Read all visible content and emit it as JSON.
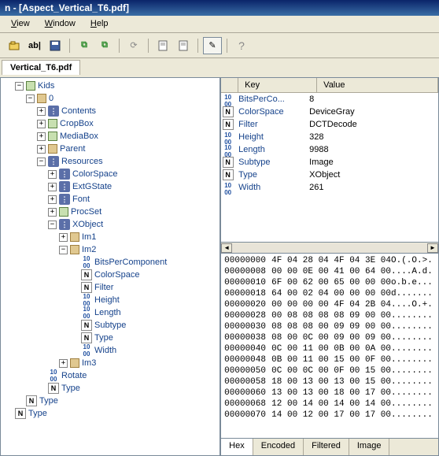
{
  "title": "n - [Aspect_Vertical_T6.pdf]",
  "menu": {
    "view": "View",
    "window": "Window",
    "help": "Help"
  },
  "toolbar": {
    "ab": "ab|",
    "help": "?"
  },
  "tab": "Vertical_T6.pdf",
  "tree": [
    {
      "d": 0,
      "exp": "-",
      "icon": "arr",
      "label": "Kids"
    },
    {
      "d": 1,
      "exp": "-",
      "icon": "dict",
      "label": "0"
    },
    {
      "d": 2,
      "exp": "+",
      "icon": "kv",
      "label": "Contents"
    },
    {
      "d": 2,
      "exp": "+",
      "icon": "arr",
      "label": "CropBox"
    },
    {
      "d": 2,
      "exp": "+",
      "icon": "arr",
      "label": "MediaBox"
    },
    {
      "d": 2,
      "exp": "+",
      "icon": "dict",
      "label": "Parent"
    },
    {
      "d": 2,
      "exp": "-",
      "icon": "kv",
      "label": "Resources"
    },
    {
      "d": 3,
      "exp": "+",
      "icon": "kv",
      "label": "ColorSpace"
    },
    {
      "d": 3,
      "exp": "+",
      "icon": "kv",
      "label": "ExtGState"
    },
    {
      "d": 3,
      "exp": "+",
      "icon": "kv",
      "label": "Font"
    },
    {
      "d": 3,
      "exp": "+",
      "icon": "arr",
      "label": "ProcSet"
    },
    {
      "d": 3,
      "exp": "-",
      "icon": "kv",
      "label": "XObject"
    },
    {
      "d": 4,
      "exp": "+",
      "icon": "dict",
      "label": "Im1"
    },
    {
      "d": 4,
      "exp": "-",
      "icon": "dict",
      "label": "Im2"
    },
    {
      "d": 5,
      "exp": "",
      "icon": "hex",
      "label": "BitsPerComponent"
    },
    {
      "d": 5,
      "exp": "",
      "icon": "n",
      "label": "ColorSpace"
    },
    {
      "d": 5,
      "exp": "",
      "icon": "n",
      "label": "Filter"
    },
    {
      "d": 5,
      "exp": "",
      "icon": "hex",
      "label": "Height"
    },
    {
      "d": 5,
      "exp": "",
      "icon": "hex",
      "label": "Length"
    },
    {
      "d": 5,
      "exp": "",
      "icon": "n",
      "label": "Subtype"
    },
    {
      "d": 5,
      "exp": "",
      "icon": "n",
      "label": "Type"
    },
    {
      "d": 5,
      "exp": "",
      "icon": "hex",
      "label": "Width"
    },
    {
      "d": 4,
      "exp": "+",
      "icon": "dict",
      "label": "Im3"
    },
    {
      "d": 2,
      "exp": "",
      "icon": "hex",
      "label": "Rotate"
    },
    {
      "d": 2,
      "exp": "",
      "icon": "n",
      "label": "Type"
    },
    {
      "d": 0,
      "exp": "",
      "icon": "n",
      "label": "Type"
    },
    {
      "d": -1,
      "exp": "",
      "icon": "n",
      "label": "Type"
    }
  ],
  "kvheader": {
    "key": "Key",
    "value": "Value"
  },
  "kv": [
    {
      "icon": "hex",
      "key": "BitsPerCo...",
      "val": "8"
    },
    {
      "icon": "n",
      "key": "ColorSpace",
      "val": "DeviceGray"
    },
    {
      "icon": "n",
      "key": "Filter",
      "val": "DCTDecode"
    },
    {
      "icon": "hex",
      "key": "Height",
      "val": "328"
    },
    {
      "icon": "hex",
      "key": "Length",
      "val": "9988"
    },
    {
      "icon": "n",
      "key": "Subtype",
      "val": "Image"
    },
    {
      "icon": "n",
      "key": "Type",
      "val": "XObject"
    },
    {
      "icon": "hex",
      "key": "Width",
      "val": "261"
    }
  ],
  "hex": [
    {
      "off": "00000000",
      "b": "4F 04 28 04 4F 04 3E 04",
      "a": "O.(.O.>."
    },
    {
      "off": "00000008",
      "b": "00 00 0E 00 41 00 64 00",
      "a": "....A.d."
    },
    {
      "off": "00000010",
      "b": "6F 00 62 00 65 00 00 00",
      "a": "o.b.e..."
    },
    {
      "off": "00000018",
      "b": "64 00 02 04 00 00 00 00",
      "a": "d......."
    },
    {
      "off": "00000020",
      "b": "00 00 00 00 4F 04 2B 04",
      "a": "....O.+."
    },
    {
      "off": "00000028",
      "b": "00 08 08 08 08 09 00 00",
      "a": "........"
    },
    {
      "off": "00000030",
      "b": "08 08 08 00 09 09 00 00",
      "a": "........"
    },
    {
      "off": "00000038",
      "b": "08 00 0C 00 09 00 09 00",
      "a": "........"
    },
    {
      "off": "00000040",
      "b": "0C 00 11 00 0B 00 0A 00",
      "a": "........"
    },
    {
      "off": "00000048",
      "b": "0B 00 11 00 15 00 0F 00",
      "a": "........"
    },
    {
      "off": "00000050",
      "b": "0C 00 0C 00 0F 00 15 00",
      "a": "........"
    },
    {
      "off": "00000058",
      "b": "18 00 13 00 13 00 15 00",
      "a": "........"
    },
    {
      "off": "00000060",
      "b": "13 00 13 00 18 00 17 00",
      "a": "........"
    },
    {
      "off": "00000068",
      "b": "12 00 14 00 14 00 14 00",
      "a": "........"
    },
    {
      "off": "00000070",
      "b": "14 00 12 00 17 00 17 00",
      "a": "........"
    }
  ],
  "btabs": {
    "hex": "Hex",
    "encoded": "Encoded",
    "filtered": "Filtered",
    "image": "Image"
  }
}
